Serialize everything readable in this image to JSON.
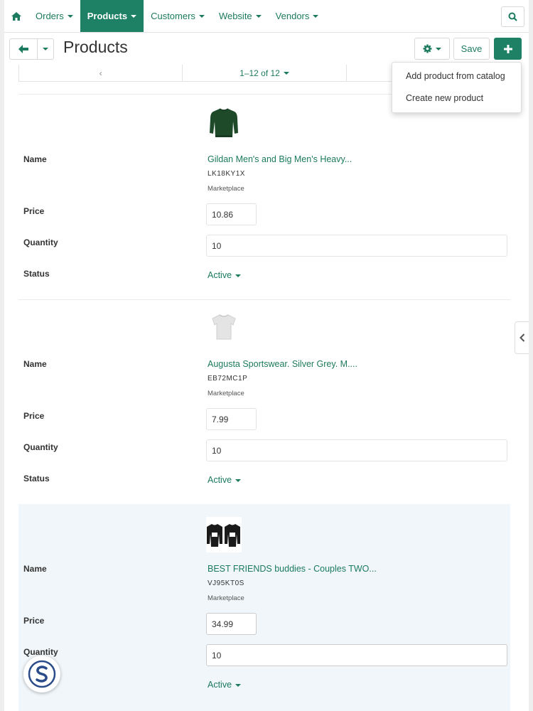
{
  "nav": {
    "items": [
      {
        "label": "Orders",
        "active": false
      },
      {
        "label": "Products",
        "active": true
      },
      {
        "label": "Customers",
        "active": false
      },
      {
        "label": "Website",
        "active": false
      },
      {
        "label": "Vendors",
        "active": false
      }
    ],
    "home_icon": "home-icon",
    "search_icon": "search-icon"
  },
  "header": {
    "title": "Products",
    "save_label": "Save"
  },
  "pager": {
    "prev": "‹",
    "range": "1–12 of 12"
  },
  "dropdown": {
    "items": [
      "Add product from catalog",
      "Create new product"
    ]
  },
  "labels": {
    "name": "Name",
    "price": "Price",
    "quantity": "Quantity",
    "status": "Status"
  },
  "products": [
    {
      "name": "Gildan Men's and Big Men's Heavy...",
      "sku": "LK18KY1X",
      "source": "Marketplace",
      "price": "10.86",
      "quantity": "10",
      "status": "Active"
    },
    {
      "name": "Augusta Sportswear. Silver Grey. M....",
      "sku": "EB72MC1P",
      "source": "Marketplace",
      "price": "7.99",
      "quantity": "10",
      "status": "Active"
    },
    {
      "name": "BEST FRIENDS buddies - Couples TWO...",
      "sku": "VJ95KT0S",
      "source": "Marketplace",
      "price": "34.99",
      "quantity": "10",
      "status": "Active"
    }
  ],
  "colors": {
    "accent": "#1e8065",
    "link": "#1c7a5e",
    "highlight_row": "#f0f6fa"
  }
}
